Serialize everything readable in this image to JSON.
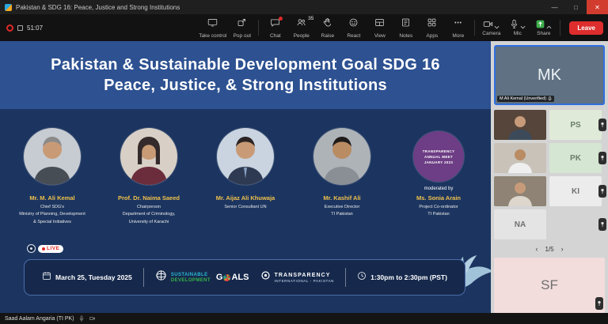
{
  "colors": {
    "slide_bg": "#1c3560",
    "title_band_bg": "#2d5191",
    "speaker_name_gold": "#f0c14b",
    "active_tile_border": "#2f6fe0",
    "leave_red": "#dd2d2d",
    "live_red": "#e02828",
    "sdg_cyan": "#29b7d3",
    "sdg_green": "#35b34a"
  },
  "window": {
    "title": "Pakistan & SDG 16: Peace, Justice and Strong Institutions",
    "recording_timer": "51:07"
  },
  "toolbar": {
    "items": [
      {
        "label": "Take control"
      },
      {
        "label": "Pop out"
      },
      {
        "label": "Chat"
      },
      {
        "label": "People",
        "badge": "35"
      },
      {
        "label": "Raise"
      },
      {
        "label": "React"
      },
      {
        "label": "View"
      },
      {
        "label": "Notes"
      },
      {
        "label": "Apps"
      },
      {
        "label": "More"
      },
      {
        "label": "Camera"
      },
      {
        "label": "Mic"
      },
      {
        "label": "Share"
      }
    ],
    "leave_label": "Leave"
  },
  "slide": {
    "title_line1": "Pakistan & Sustainable Development Goal SDG 16",
    "title_line2": "Peace, Justice, & Strong Institutions",
    "live_label": "LIVE",
    "speakers": [
      {
        "name": "Mr. M. Ali Kemal",
        "roles": [
          "Chief SDG's",
          "Ministry of Planning, Development",
          "& Special Initiatives"
        ]
      },
      {
        "name": "Prof. Dr. Naima Saeed",
        "roles": [
          "Chairperson",
          "Department of Criminology,",
          "University of Karachi"
        ]
      },
      {
        "name": "Mr. Aijaz Ali Khuwaja",
        "roles": [
          "Senior Consultant UN"
        ]
      },
      {
        "name": "Mr. Kashif Ali",
        "roles": [
          "Executive Director",
          "TI Pakistan"
        ]
      },
      {
        "name": "Ms. Sonia Arain",
        "roles": [
          "Project Co-ordinator",
          "TI Pakistan"
        ],
        "moderated_by": "moderated by",
        "overlay_lines": [
          "TRANSPARENCY",
          "ANNUAL MEET",
          "JANUARY 2023"
        ]
      }
    ],
    "footer": {
      "date": "March 25, Tuesday 2025",
      "time": "1:30pm to 2:30pm (PST)",
      "sdg_line1": "SUSTAINABLE",
      "sdg_line2": "DEVELOPMENT",
      "goals_g": "G",
      "goals_als": "ALS",
      "ti_line1": "TRANSPARENCY",
      "ti_line2": "INTERNATIONAL - PAKISTAN"
    }
  },
  "sidebar": {
    "active_tile": {
      "initials": "MK",
      "name_label": "M Ali Kemal (Unverified)"
    },
    "tiles": [
      {
        "initials": "PS"
      },
      {
        "initials": "PK"
      },
      {
        "initials": "KI"
      },
      {
        "initials": "NA"
      },
      {
        "initials": "SF"
      }
    ],
    "pagination": "1/5"
  },
  "statusbar": {
    "participant_label": "Saad Aalam Angaria (TI PK)"
  }
}
